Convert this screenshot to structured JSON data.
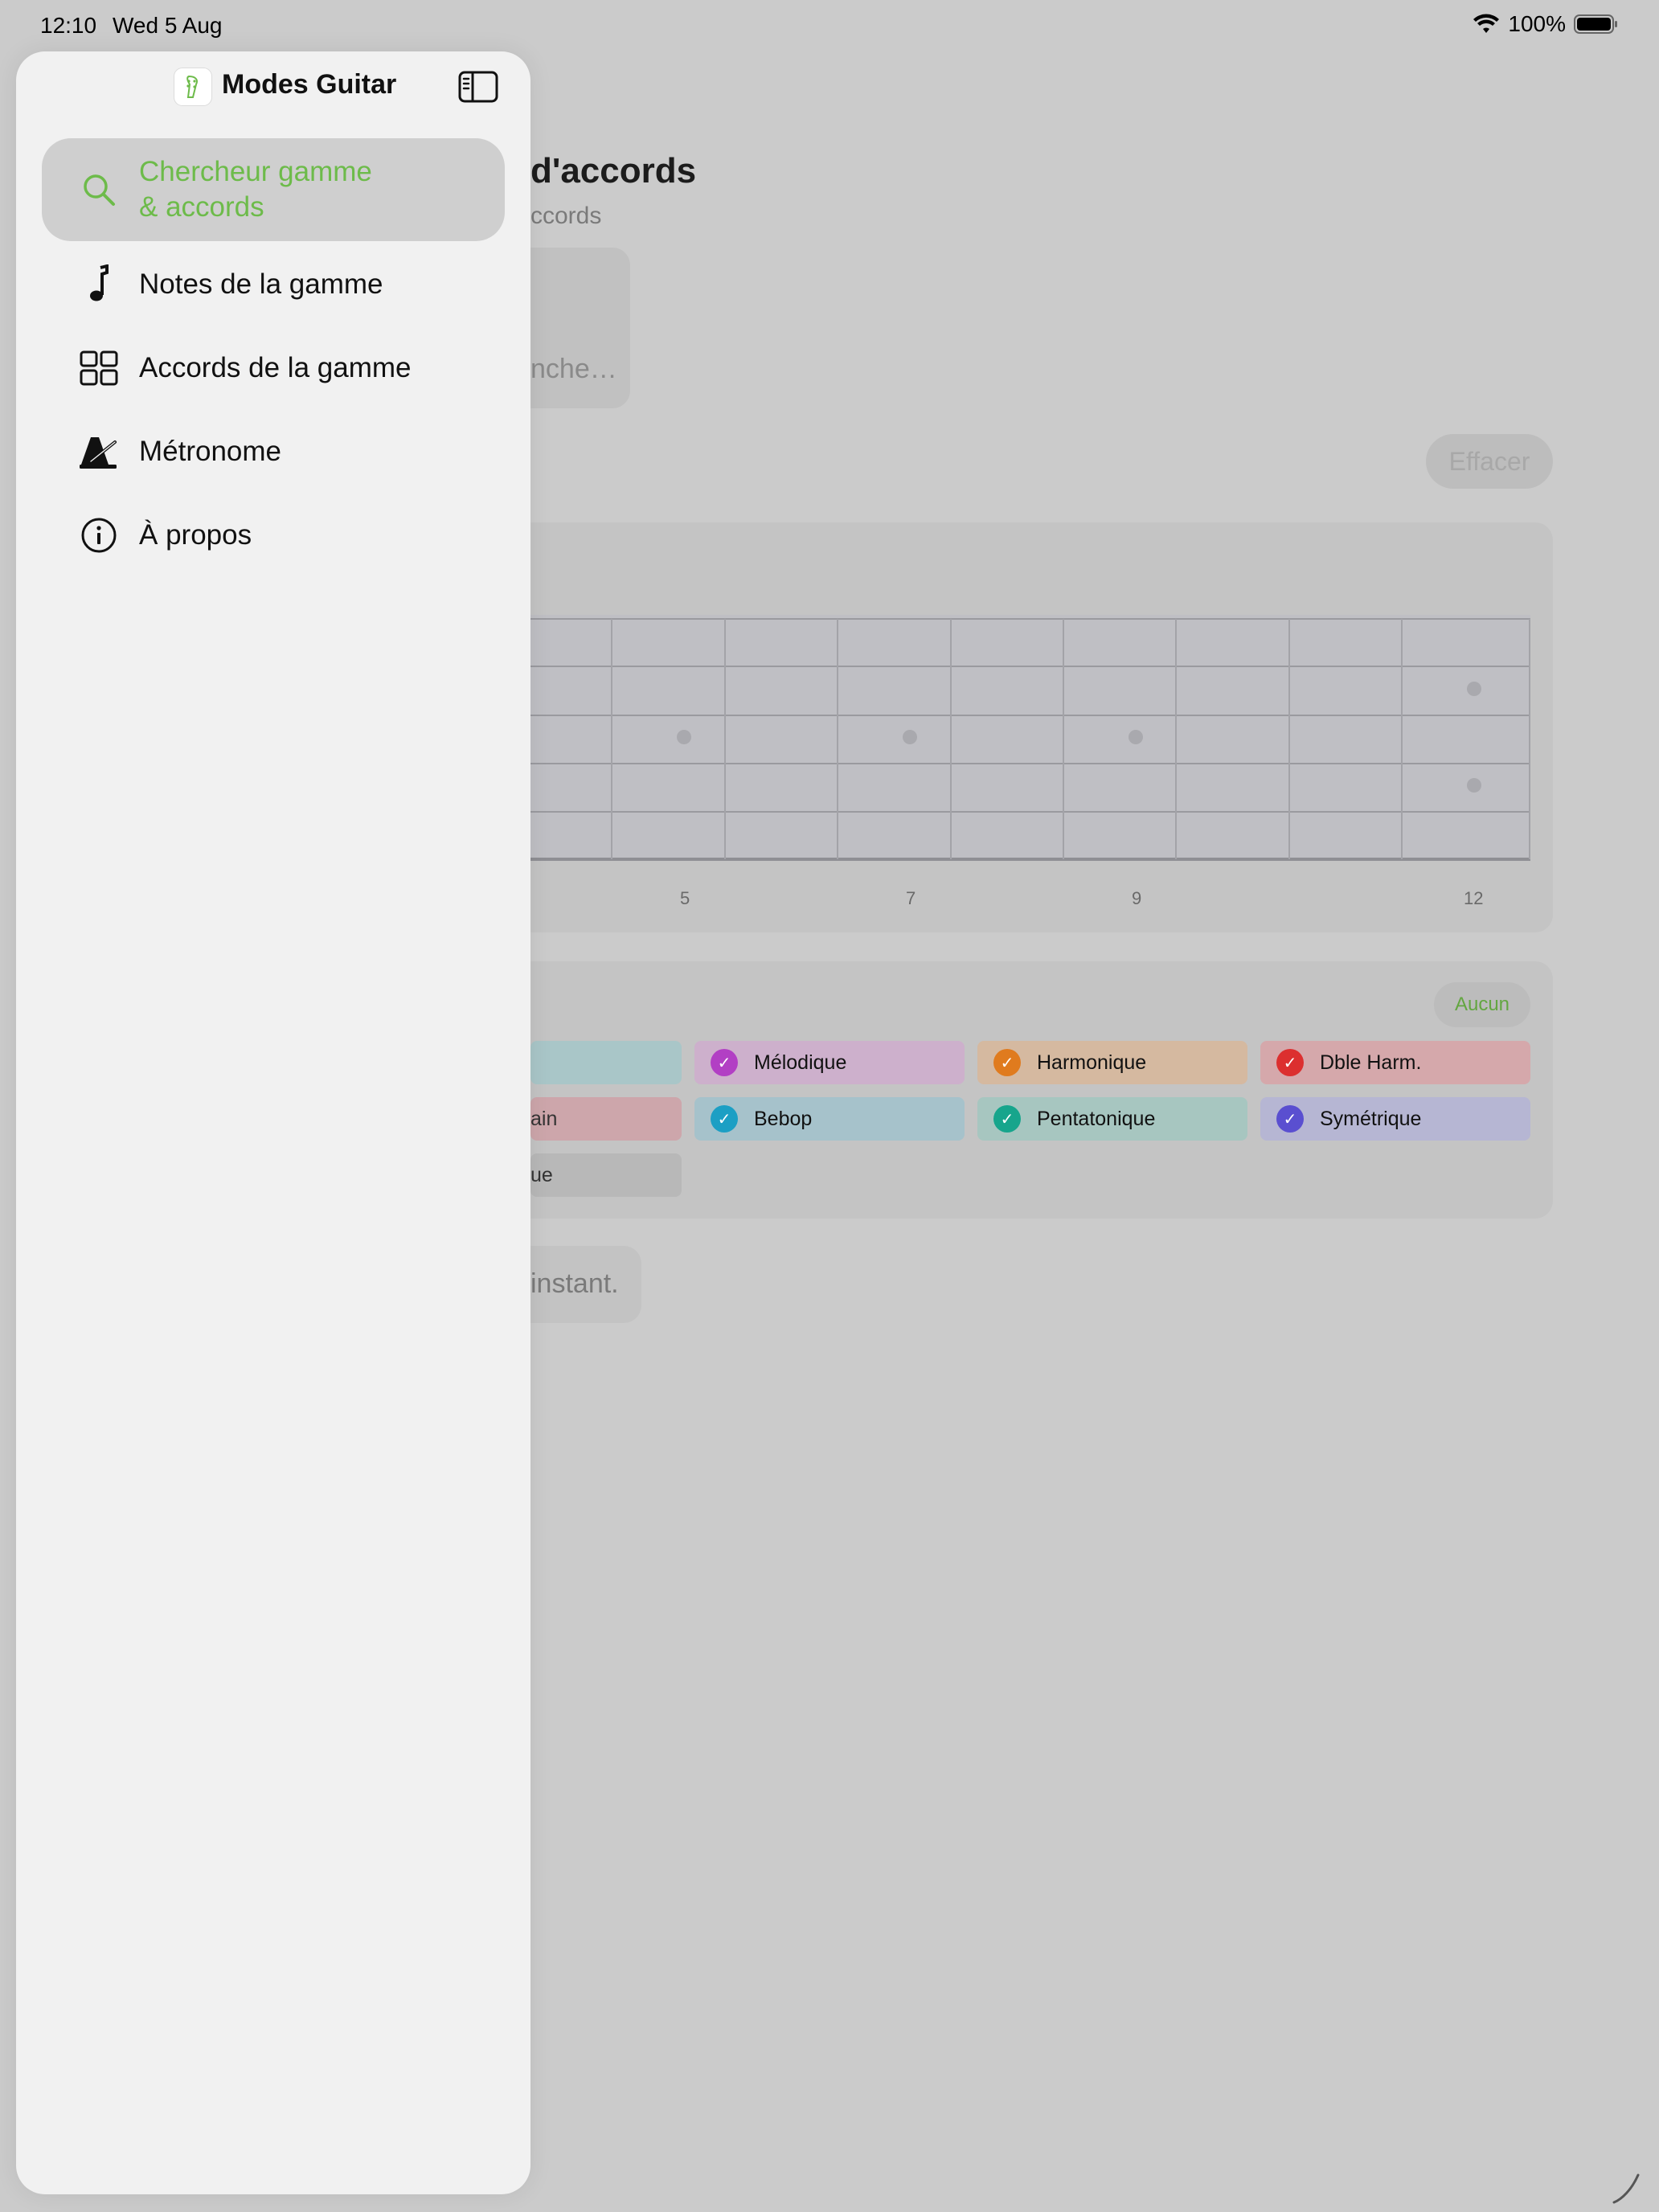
{
  "status": {
    "time": "12:10",
    "date": "Wed 5 Aug",
    "battery": "100%"
  },
  "sidebar": {
    "app_title": "Modes Guitar",
    "accent_color": "#6dbb4a",
    "items": [
      {
        "label": "Chercheur gamme & accords",
        "icon": "search-icon",
        "active": true
      },
      {
        "label": "Notes de la gamme",
        "icon": "music-note-icon",
        "active": false
      },
      {
        "label": "Accords de la gamme",
        "icon": "grid-icon",
        "active": false
      },
      {
        "label": "Métronome",
        "icon": "metronome-icon",
        "active": false
      },
      {
        "label": "À propos",
        "icon": "info-icon",
        "active": false
      }
    ]
  },
  "main": {
    "title_visible": "d'accords",
    "subtitle_visible": "ccords",
    "search_placeholder_visible": "nche…",
    "clear_label": "Effacer",
    "fret_labels": [
      "5",
      "7",
      "9",
      "12"
    ],
    "none_label": "Aucun",
    "categories": [
      {
        "label": "Mélodique",
        "color": "#b23fc4",
        "bg": "#cdb0cc"
      },
      {
        "label": "Harmonique",
        "color": "#e07b1e",
        "bg": "#d5b9a0"
      },
      {
        "label": "Dble Harm.",
        "color": "#dc2f2f",
        "bg": "#d5a8ab"
      },
      {
        "label": "Bebop",
        "color": "#1c9fc4",
        "bg": "#a6c2cb"
      },
      {
        "label": "Pentatonique",
        "color": "#17a58c",
        "bg": "#a7c6c0"
      },
      {
        "label": "Symétrique",
        "color": "#5a4fd0",
        "bg": "#b6b6d3"
      }
    ],
    "partial_chips": [
      "ain",
      "ue"
    ],
    "empty_text_visible": "instant."
  }
}
